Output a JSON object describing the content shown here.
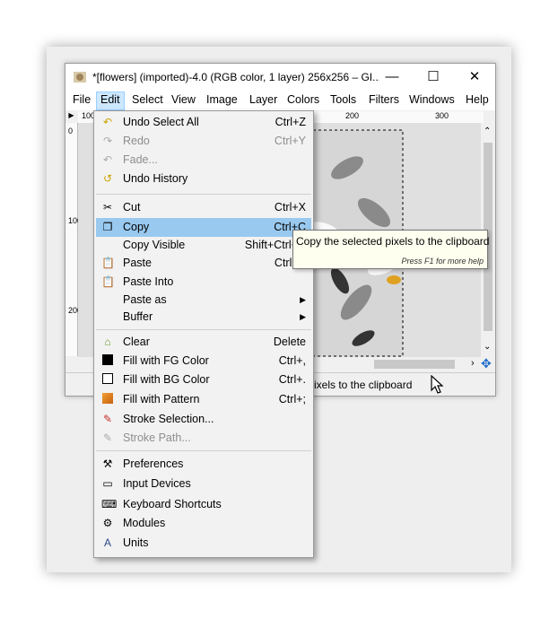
{
  "window": {
    "title": "*[flowers] (imported)-4.0 (RGB color, 1 layer) 256x256 – GI...",
    "minimize": "—",
    "maximize": "☐",
    "close": "✕"
  },
  "menubar": [
    "File",
    "Edit",
    "Select",
    "View",
    "Image",
    "Layer",
    "Colors",
    "Tools",
    "Filters",
    "Windows",
    "Help"
  ],
  "ruler": {
    "top_ticks": [
      "100",
      "200",
      "300"
    ],
    "left_ticks": [
      "0",
      "100",
      "200"
    ]
  },
  "status": {
    "text": "ixels to the clipboard"
  },
  "tooltip": {
    "text": "Copy the selected pixels to the clipboard",
    "hint": "Press F1 for more help"
  },
  "edit_menu": [
    {
      "label": "Undo Select All",
      "shortcut": "Ctrl+Z",
      "icon": "undo-icon",
      "disabled": false
    },
    {
      "label": "Redo",
      "shortcut": "Ctrl+Y",
      "icon": "redo-icon",
      "disabled": true
    },
    {
      "label": "Fade...",
      "shortcut": "",
      "icon": "fade-icon",
      "disabled": true
    },
    {
      "label": "Undo History",
      "shortcut": "",
      "icon": "undo-history-icon",
      "disabled": false
    },
    {
      "label": "Cut",
      "shortcut": "Ctrl+X",
      "icon": "scissors-icon",
      "disabled": false
    },
    {
      "label": "Copy",
      "shortcut": "Ctrl+C",
      "icon": "copy-icon",
      "disabled": false,
      "highlighted": true
    },
    {
      "label": "Copy Visible",
      "shortcut": "Shift+Ctrl+C",
      "icon": "",
      "disabled": false
    },
    {
      "label": "Paste",
      "shortcut": "Ctrl+V",
      "icon": "paste-icon",
      "disabled": false
    },
    {
      "label": "Paste Into",
      "shortcut": "",
      "icon": "paste-into-icon",
      "disabled": false
    },
    {
      "label": "Paste as",
      "shortcut": "",
      "icon": "",
      "disabled": false,
      "submenu": true
    },
    {
      "label": "Buffer",
      "shortcut": "",
      "icon": "",
      "disabled": false,
      "submenu": true
    },
    {
      "label": "Clear",
      "shortcut": "Delete",
      "icon": "clear-icon",
      "disabled": false
    },
    {
      "label": "Fill with FG Color",
      "shortcut": "Ctrl+,",
      "icon": "fg-color-icon",
      "disabled": false
    },
    {
      "label": "Fill with BG Color",
      "shortcut": "Ctrl+.",
      "icon": "bg-color-icon",
      "disabled": false
    },
    {
      "label": "Fill with Pattern",
      "shortcut": "Ctrl+;",
      "icon": "pattern-icon",
      "disabled": false
    },
    {
      "label": "Stroke Selection...",
      "shortcut": "",
      "icon": "stroke-selection-icon",
      "disabled": false
    },
    {
      "label": "Stroke Path...",
      "shortcut": "",
      "icon": "stroke-path-icon",
      "disabled": true
    },
    {
      "label": "Preferences",
      "shortcut": "",
      "icon": "preferences-icon",
      "disabled": false
    },
    {
      "label": "Input Devices",
      "shortcut": "",
      "icon": "input-devices-icon",
      "disabled": false
    },
    {
      "label": "Keyboard Shortcuts",
      "shortcut": "",
      "icon": "keyboard-icon",
      "disabled": false
    },
    {
      "label": "Modules",
      "shortcut": "",
      "icon": "modules-icon",
      "disabled": false
    },
    {
      "label": "Units",
      "shortcut": "",
      "icon": "units-icon",
      "disabled": false
    }
  ]
}
